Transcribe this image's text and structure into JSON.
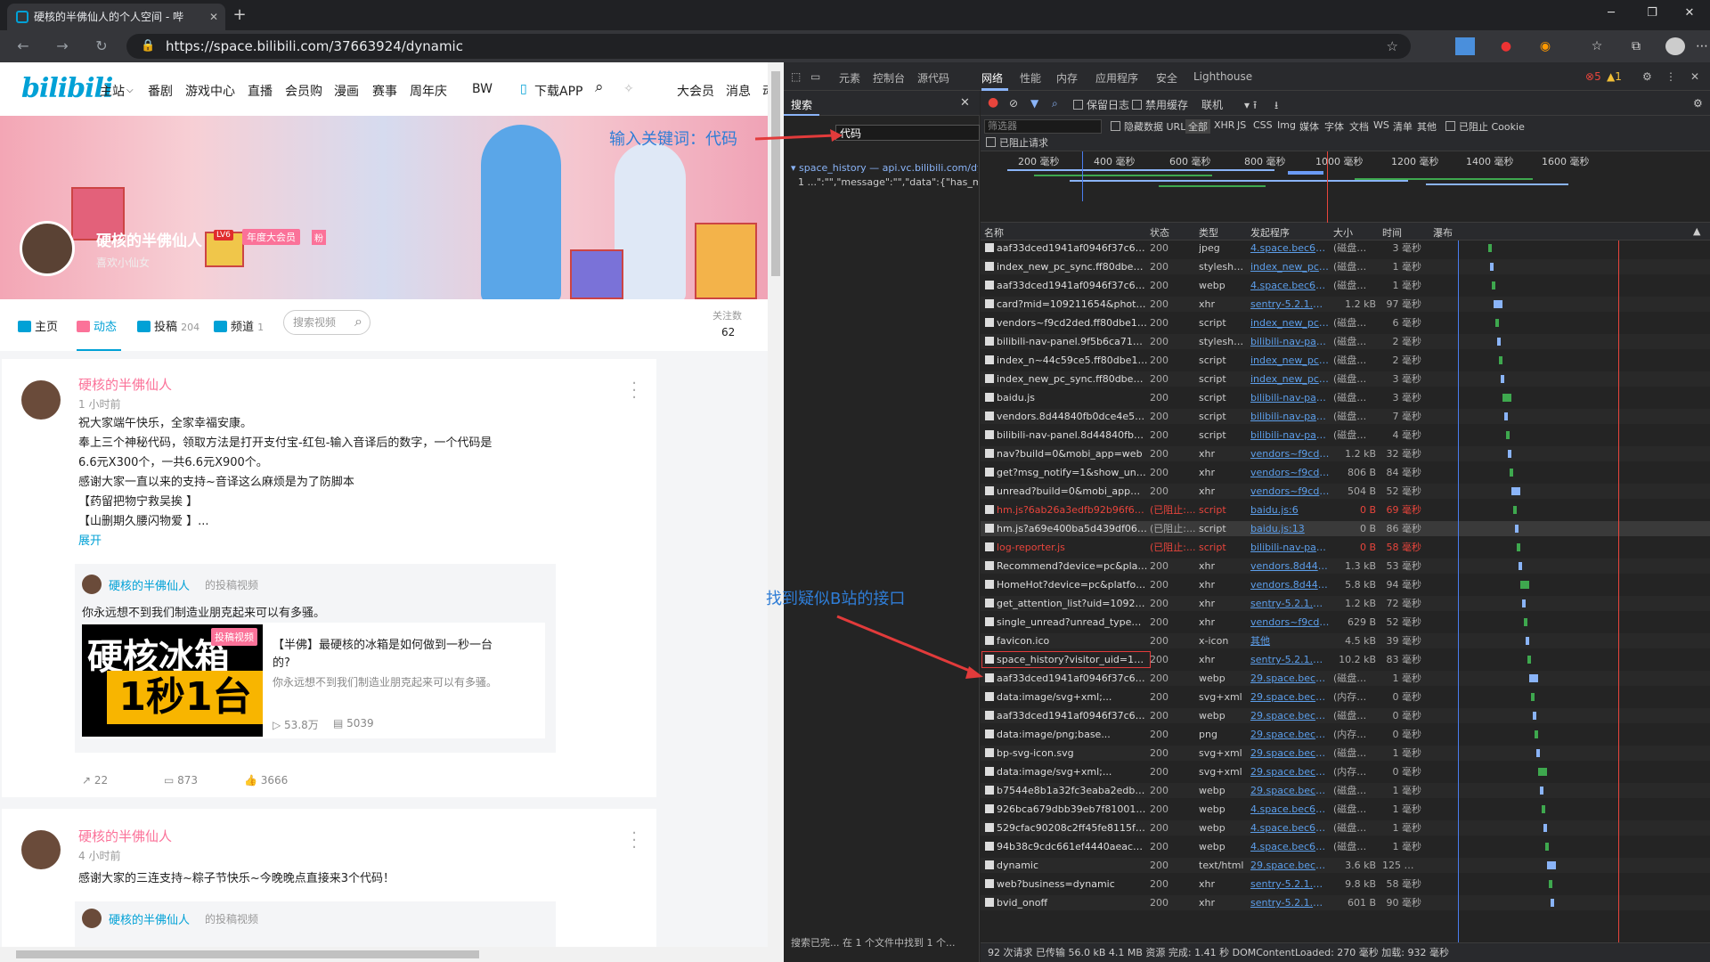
{
  "browser": {
    "tab_title": "硬核的半佛仙人的个人空间 - 哔",
    "tab_close": "✕",
    "new_tab": "+",
    "url": "https://space.bilibili.com/37663924/dynamic",
    "win_min": "─",
    "win_max": "❐",
    "win_close": "✕"
  },
  "site": {
    "logo": "bilibili",
    "nav": [
      "主站",
      "番剧",
      "游戏中心",
      "直播",
      "会员购",
      "漫画",
      "赛事",
      "周年庆",
      "BW",
      "下载APP",
      "大会员",
      "消息",
      "动态"
    ],
    "user": {
      "name": "硬核的半佛仙人",
      "level": "LV6",
      "vip": "年度大会员",
      "badge": "粉",
      "sign": "喜欢小仙女"
    },
    "subnav": {
      "home": "主页",
      "dynamic": "动态",
      "videos": "投稿",
      "videos_count": "204",
      "channel": "频道",
      "channel_count": "1",
      "search_placeholder": "搜索视频",
      "follow_label": "关注数",
      "follow_count": "62"
    },
    "posts": [
      {
        "name": "硬核的半佛仙人",
        "time": "1 小时前",
        "lines": [
          "祝大家端午快乐，全家幸福安康。",
          "奉上三个神秘代码，领取方法是打开支付宝-红包-输入音译后的数字，一个代码是",
          "6.6元X300个，一共6.6元X900个。",
          "感谢大家一直以来的支持~音译这么麻烦是为了防脚本",
          "【药留把物宁救吴挨 】",
          "【山删期久腰闪物爱 】..."
        ],
        "expand": "展开",
        "repost": {
          "name": "硬核的半佛仙人",
          "suffix": "的投稿视频",
          "text": "你永远想不到我们制造业朋克起来可以有多骚。",
          "thumb_line1": "硬核冰箱",
          "thumb_line2": "1秒1台",
          "thumb_tag": "投稿视频",
          "video_title_1": "【半佛】最硬核的冰箱是如何做到一秒一台",
          "video_title_2": "的?",
          "video_desc": "你永远想不到我们制造业朋克起来可以有多骚。",
          "plays": "53.8万",
          "danmaku": "5039"
        },
        "shares": "22",
        "comments": "873",
        "likes": "3666"
      },
      {
        "name": "硬核的半佛仙人",
        "time": "4 小时前",
        "text": "感谢大家的三连支持~粽子节快乐~今晚晚点直接来3个代码！",
        "repost_name": "硬核的半佛仙人",
        "repost_suffix": "的投稿视频"
      }
    ]
  },
  "devtools": {
    "tabs": [
      "元素",
      "控制台",
      "源代码",
      "网络",
      "性能",
      "内存",
      "应用程序",
      "安全",
      "Lighthouse"
    ],
    "errors": "5",
    "warnings": "1",
    "search": {
      "title": "搜索",
      "query": "代码",
      "result_file": "space_history — api.vc.bilibili.com/dy...",
      "result_line": "1  ...\":\"\",\"message\":\"\",\"data\":{\"has_mor...",
      "status": "搜索已完...  在 1 个文件中找到 1 个..."
    },
    "toolbar": {
      "preserve_log": "保留日志",
      "disable_cache": "禁用缓存",
      "throttle": "联机"
    },
    "filter": {
      "placeholder": "筛选器",
      "hide_data_url": "隐藏数据 URL",
      "types": [
        "全部",
        "XHR",
        "JS",
        "CSS",
        "Img",
        "媒体",
        "字体",
        "文档",
        "WS",
        "清单",
        "其他"
      ],
      "blocked_cookie": "已阻止 Cookie",
      "blocked_requests": "已阻止请求"
    },
    "overview_ticks": [
      "200 毫秒",
      "400 毫秒",
      "600 毫秒",
      "800 毫秒",
      "1000 毫秒",
      "1200 毫秒",
      "1400 毫秒",
      "1600 毫秒"
    ],
    "columns": [
      "名称",
      "状态",
      "类型",
      "发起程序",
      "大小",
      "时间",
      "瀑布"
    ],
    "rows": [
      [
        "aaf33dced1941af0946f37c62f4b48fc...",
        "200",
        "jpeg",
        "4.space.bec6490...",
        "(磁盘缓存)",
        "3 毫秒",
        ""
      ],
      [
        "index_new_pc_sync.ff80dbe1.css",
        "200",
        "stylesheet",
        "index_new_pc_sync",
        "(磁盘缓存)",
        "1 毫秒",
        ""
      ],
      [
        "aaf33dced1941af0946f37c62f4b48fc...",
        "200",
        "webp",
        "4.space.bec6490...",
        "(磁盘缓存)",
        "1 毫秒",
        ""
      ],
      [
        "card?mid=109211654&photo=true",
        "200",
        "xhr",
        "sentry-5.2.1.min.js:2",
        "1.2 kB",
        "97 毫秒",
        ""
      ],
      [
        "vendors~f9cd2ded.ff80dbe1.js",
        "200",
        "script",
        "index_new_pc_sync",
        "(磁盘缓存)",
        "6 毫秒",
        ""
      ],
      [
        "bilibili-nav-panel.9f5b6ca710e40487...",
        "200",
        "stylesheet",
        "bilibili-nav-panel....",
        "(磁盘缓存)",
        "2 毫秒",
        ""
      ],
      [
        "index_n~44c59ce5.ff80dbe1.js",
        "200",
        "script",
        "index_new_pc_sync",
        "(磁盘缓存)",
        "2 毫秒",
        ""
      ],
      [
        "index_new_pc_sync.ff80dbe1.js",
        "200",
        "script",
        "index_new_pc_sync",
        "(磁盘缓存)",
        "3 毫秒",
        ""
      ],
      [
        "baidu.js",
        "200",
        "script",
        "bilibili-nav-panel....",
        "(磁盘缓存)",
        "3 毫秒",
        ""
      ],
      [
        "vendors.8d44840fb0dce4e5ad7f.js",
        "200",
        "script",
        "bilibili-nav-panel....",
        "(磁盘缓存)",
        "7 毫秒",
        ""
      ],
      [
        "bilibili-nav-panel.8d44840fb0dce4e...",
        "200",
        "script",
        "bilibili-nav-panel....",
        "(磁盘缓存)",
        "4 毫秒",
        ""
      ],
      [
        "nav?build=0&mobi_app=web",
        "200",
        "xhr",
        "vendors~f9cd2de...",
        "1.2 kB",
        "32 毫秒",
        ""
      ],
      [
        "get?msg_notify=1&show_unfollowe...",
        "200",
        "xhr",
        "vendors~f9cd2de...",
        "806 B",
        "84 毫秒",
        ""
      ],
      [
        "unread?build=0&mobi_app=web",
        "200",
        "xhr",
        "vendors~f9cd2de...",
        "504 B",
        "52 毫秒",
        ""
      ],
      [
        "hm.js?6ab26a3edfb92b96f655b43a8...",
        "(已阻止:...",
        "script",
        "baidu.js:6",
        "0 B",
        "69 毫秒",
        "err"
      ],
      [
        "hm.js?a69e400ba5d439df060bf330c...",
        "(已阻止:...",
        "script",
        "baidu.js:13",
        "0 B",
        "86 毫秒",
        "sel"
      ],
      [
        "log-reporter.js",
        "(已阻止:...",
        "script",
        "bilibili-nav-panel....",
        "0 B",
        "58 毫秒",
        "err"
      ],
      [
        "Recommend?device=pc&platform=...",
        "200",
        "xhr",
        "vendors.8d44840...",
        "1.3 kB",
        "53 毫秒",
        ""
      ],
      [
        "HomeHot?device=pc&platform=web",
        "200",
        "xhr",
        "vendors.8d44840...",
        "5.8 kB",
        "94 毫秒",
        ""
      ],
      [
        "get_attention_list?uid=109211654",
        "200",
        "xhr",
        "sentry-5.2.1.min.js:2",
        "1.2 kB",
        "72 毫秒",
        ""
      ],
      [
        "single_unread?unread_type=0&buil...",
        "200",
        "xhr",
        "vendors~f9cd2de...",
        "629 B",
        "52 毫秒",
        ""
      ],
      [
        "favicon.ico",
        "200",
        "x-icon",
        "其他",
        "4.5 kB",
        "39 毫秒",
        ""
      ],
      [
        "space_history?visitor_uid=10921165...",
        "200",
        "xhr",
        "sentry-5.2.1.min.js:2",
        "10.2 kB",
        "83 毫秒",
        ""
      ],
      [
        "aaf33dced1941af0946f37c62f4b48fc...",
        "200",
        "webp",
        "29.space.bec6490...",
        "(磁盘缓存)",
        "1 毫秒",
        ""
      ],
      [
        "data:image/svg+xml;...",
        "200",
        "svg+xml",
        "29.space.bec6490...",
        "(内存缓存)",
        "0 毫秒",
        ""
      ],
      [
        "aaf33dced1941af0946f37c62f4b48fc...",
        "200",
        "webp",
        "29.space.bec6490...",
        "(磁盘缓存)",
        "0 毫秒",
        ""
      ],
      [
        "data:image/png;base...",
        "200",
        "png",
        "29.space.bec6490...",
        "(内存缓存)",
        "0 毫秒",
        ""
      ],
      [
        "bp-svg-icon.svg",
        "200",
        "svg+xml",
        "29.space.bec6490...",
        "(磁盘缓存)",
        "1 毫秒",
        ""
      ],
      [
        "data:image/svg+xml;...",
        "200",
        "svg+xml",
        "29.space.bec6490...",
        "(内存缓存)",
        "0 毫秒",
        ""
      ],
      [
        "b7544e8b1a32fc3eaba2edb61d8d8...",
        "200",
        "webp",
        "29.space.bec6490...",
        "(磁盘缓存)",
        "1 毫秒",
        ""
      ],
      [
        "926bca679dbb39eb7f810010d183f0...",
        "200",
        "webp",
        "4.space.bec6490...",
        "(磁盘缓存)",
        "1 毫秒",
        ""
      ],
      [
        "529cfac90208c2ff45fe8115f3c0d84e...",
        "200",
        "webp",
        "4.space.bec6490...",
        "(磁盘缓存)",
        "1 毫秒",
        ""
      ],
      [
        "94b38c9cdc661ef4440aeac15ed156...",
        "200",
        "webp",
        "4.space.bec6490...",
        "(磁盘缓存)",
        "1 毫秒",
        ""
      ],
      [
        "dynamic",
        "200",
        "text/html",
        "29.space.bec6490...",
        "3.6 kB",
        "125 毫秒",
        ""
      ],
      [
        "web?business=dynamic",
        "200",
        "xhr",
        "sentry-5.2.1.min.js:2",
        "9.8 kB",
        "58 毫秒",
        ""
      ],
      [
        "bvid_onoff",
        "200",
        "xhr",
        "sentry-5.2.1.min.js:2",
        "601 B",
        "90 毫秒",
        ""
      ]
    ],
    "footer": "92 次请求  已传输 56.0 kB  4.1 MB 资源  完成: 1.41 秒  DOMContentLoaded: 270 毫秒  加载: 932 毫秒"
  },
  "annotations": {
    "input_hint": "输入关键词：代码",
    "found_hint": "找到疑似B站的接口"
  }
}
